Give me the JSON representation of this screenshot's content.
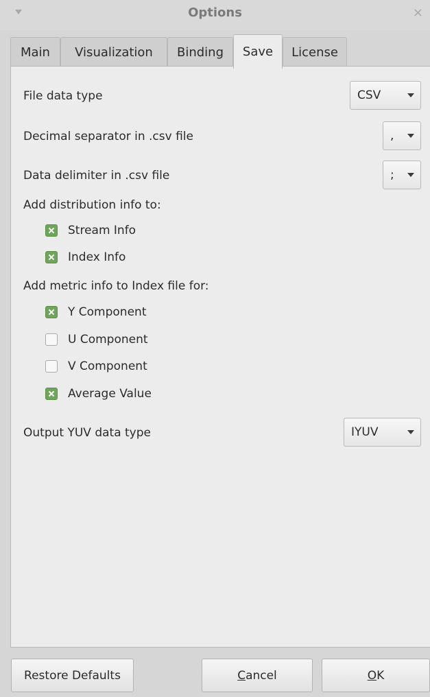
{
  "window": {
    "title": "Options"
  },
  "tabs": [
    {
      "label": "Main"
    },
    {
      "label": "Visualization"
    },
    {
      "label": "Binding"
    },
    {
      "label": "Save",
      "active": true
    },
    {
      "label": "License"
    }
  ],
  "save": {
    "file_data_type": {
      "label": "File data type",
      "value": "CSV"
    },
    "decimal_separator": {
      "label": "Decimal separator in .csv file",
      "value": ","
    },
    "data_delimiter": {
      "label": "Data delimiter in .csv file",
      "value": ";"
    },
    "distribution_heading": "Add distribution info to:",
    "distribution": [
      {
        "label": "Stream Info",
        "checked": true
      },
      {
        "label": "Index Info",
        "checked": true
      }
    ],
    "metric_heading": "Add metric info to Index file for:",
    "metric": [
      {
        "label": "Y Component",
        "checked": true
      },
      {
        "label": "U Component",
        "checked": false
      },
      {
        "label": "V Component",
        "checked": false
      },
      {
        "label": "Average Value",
        "checked": true
      }
    ],
    "output_yuv": {
      "label": "Output YUV data type",
      "value": "IYUV"
    }
  },
  "buttons": {
    "restore": "Restore Defaults",
    "cancel_first": "C",
    "cancel_rest": "ancel",
    "ok_first": "O",
    "ok_rest": "K"
  },
  "colors": {
    "checked": "#6fa55a",
    "panel": "#ececec",
    "frame": "#d6d6d6"
  }
}
